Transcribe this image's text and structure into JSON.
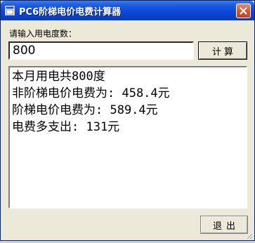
{
  "window": {
    "title": "PC6阶梯电价电费计算器",
    "icons": {
      "app": "app-window-icon",
      "close": "close-icon"
    }
  },
  "form": {
    "prompt_label": "请输入用电度数：",
    "amount_value": "800",
    "calc_button_label": "计算"
  },
  "result": {
    "lines": [
      "本月用电共800度",
      "非阶梯电价电费为: 458.4元",
      "阶梯电价电费为: 589.4元",
      "电费多支出: 131元"
    ]
  },
  "footer": {
    "exit_button_label": "退出"
  },
  "colors": {
    "titlebar": "#0b48d6",
    "window_bg": "#ece9d8",
    "close_button": "#d55a33"
  }
}
